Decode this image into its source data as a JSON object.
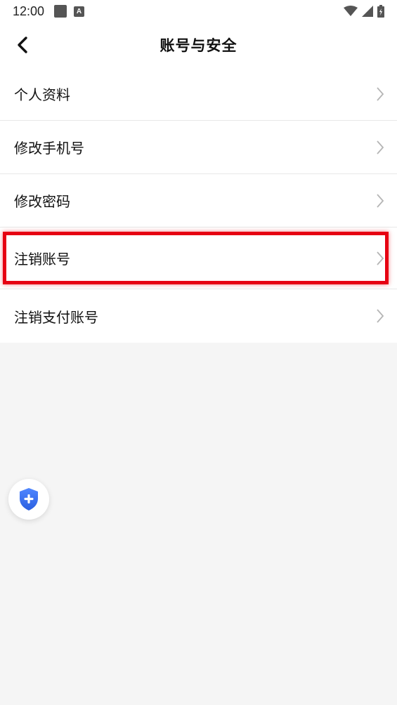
{
  "status_bar": {
    "time": "12:00",
    "indicator_a": "A"
  },
  "header": {
    "title": "账号与安全"
  },
  "menu": {
    "items": [
      {
        "label": "个人资料"
      },
      {
        "label": "修改手机号"
      },
      {
        "label": "修改密码"
      },
      {
        "label": "注销账号",
        "highlighted": true
      },
      {
        "label": "注销支付账号"
      }
    ]
  },
  "colors": {
    "highlight": "#e60012",
    "fab_icon": "#3b6ff5",
    "background": "#f5f5f5"
  },
  "icons": [
    "chevron-left-icon",
    "chevron-right-icon",
    "shield-plus-icon",
    "wifi-icon",
    "signal-icon",
    "battery-icon"
  ]
}
